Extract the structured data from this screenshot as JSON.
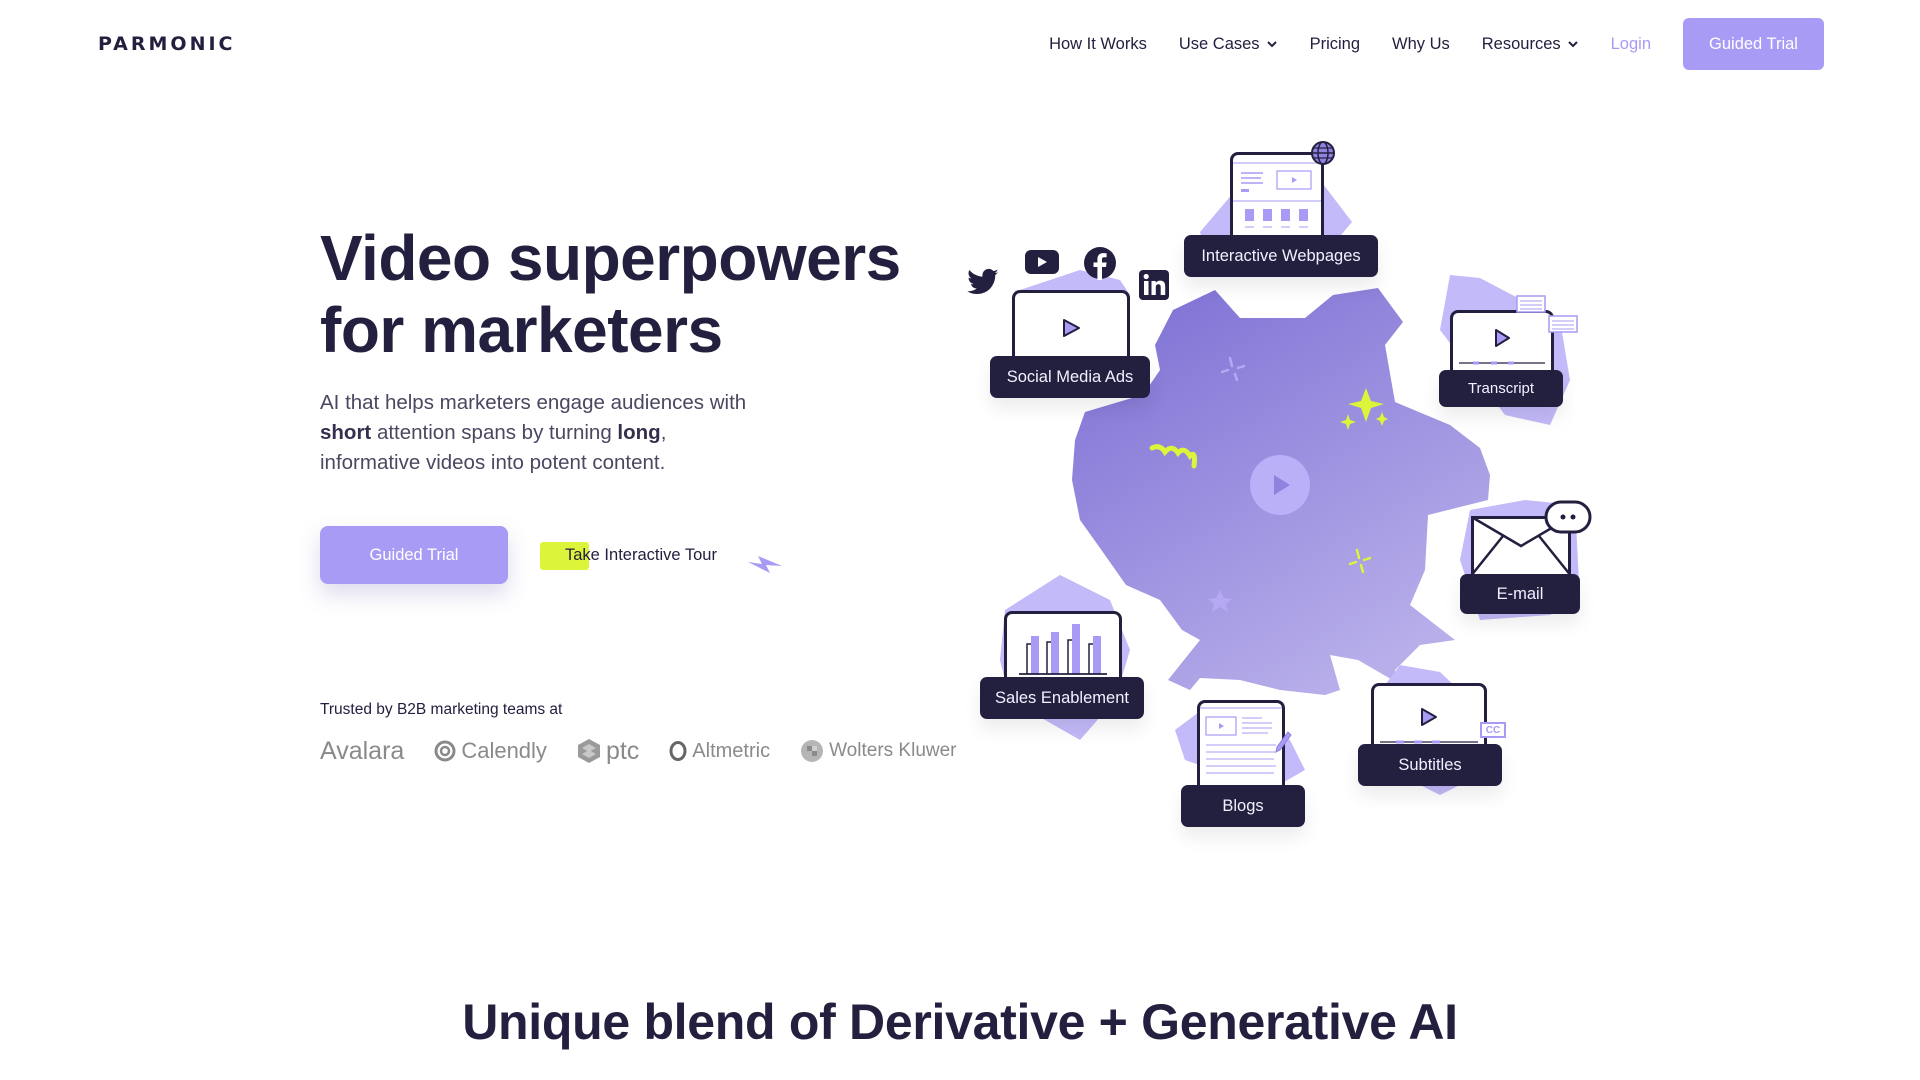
{
  "brand": {
    "name": "PARMONIC",
    "accent": "#a79bf5",
    "dark": "#23203f",
    "highlight": "#dcf53b"
  },
  "nav": {
    "items": [
      {
        "label": "How It Works",
        "dropdown": false
      },
      {
        "label": "Use Cases",
        "dropdown": true
      },
      {
        "label": "Pricing",
        "dropdown": false
      },
      {
        "label": "Why Us",
        "dropdown": false
      },
      {
        "label": "Resources",
        "dropdown": true
      }
    ],
    "login": "Login",
    "cta": "Guided Trial"
  },
  "hero": {
    "title_line1": "Video superpowers",
    "title_line2": "for marketers",
    "sub_part1": "AI that helps marketers engage audiences with ",
    "sub_bold1": "short",
    "sub_part2": " attention spans by turning ",
    "sub_bold2": "long",
    "sub_part3": ", informative videos into potent content.",
    "cta_primary": "Guided Trial",
    "cta_secondary": "Take Interactive Tour"
  },
  "trusted": {
    "label": "Trusted by B2B marketing teams at",
    "logos": [
      "Avalara",
      "Calendly",
      "ptc",
      "Altmetric",
      "Wolters Kluwer"
    ]
  },
  "illustration": {
    "center_icon": "play-icon",
    "social_icons": [
      "twitter-icon",
      "youtube-icon",
      "facebook-icon",
      "linkedin-icon"
    ],
    "cards": [
      {
        "label": "Interactive Webpages",
        "icon": "webpage-icon"
      },
      {
        "label": "Social Media Ads",
        "icon": "video-icon"
      },
      {
        "label": "Transcript",
        "icon": "transcript-icon"
      },
      {
        "label": "E-mail",
        "icon": "email-icon"
      },
      {
        "label": "Sales Enablement",
        "icon": "bar-chart-icon"
      },
      {
        "label": "Blogs",
        "icon": "blog-icon"
      },
      {
        "label": "Subtitles",
        "icon": "subtitles-icon",
        "badge": "CC"
      }
    ]
  },
  "section2": {
    "title": "Unique blend of Derivative + Generative AI"
  }
}
